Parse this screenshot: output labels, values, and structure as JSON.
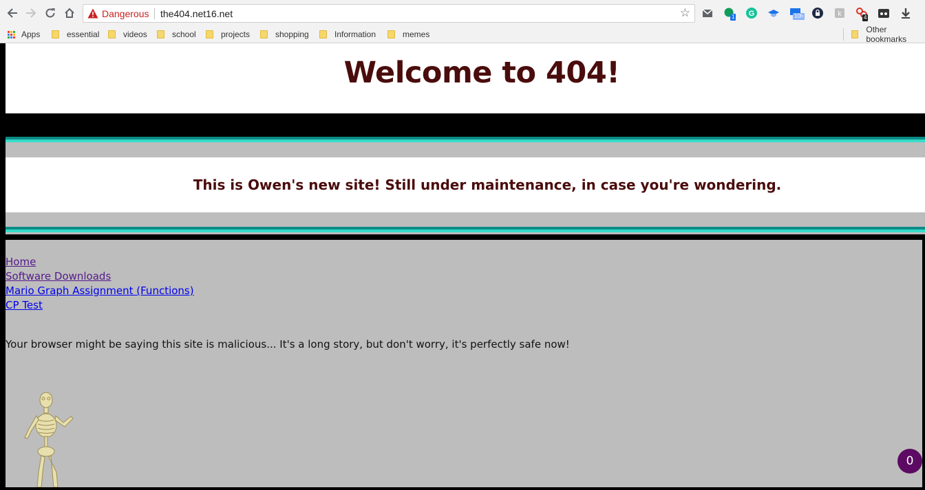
{
  "browser": {
    "security_label": "Dangerous",
    "url": "the404.net16.net",
    "extension_badges": [
      "1",
      "10h",
      "4"
    ],
    "bookmarks": [
      "Apps",
      "essential",
      "videos",
      "school",
      "projects",
      "shopping",
      "Information",
      "memes"
    ],
    "other_bookmarks": "Other bookmarks"
  },
  "page": {
    "title": "Welcome to 404!",
    "message": "This is Owen's new site! Still under maintenance, in case you're wondering.",
    "nav_links": [
      {
        "label": "Home",
        "visited": true
      },
      {
        "label": "Software Downloads",
        "visited": true
      },
      {
        "label": "Mario Graph Assignment (Functions)",
        "visited": false
      },
      {
        "label": "CP Test",
        "visited": false
      }
    ],
    "notice": "Your browser might be saying this site is malicious... It's a long story, but don't worry, it's perfectly safe now!",
    "counter": "0"
  },
  "colors": {
    "title": "#4a0c0c",
    "danger": "#c5221f",
    "stripe_dark": "#0b8c86",
    "stripe_light": "#36dcc9",
    "counter_bg": "#5c0a63"
  }
}
